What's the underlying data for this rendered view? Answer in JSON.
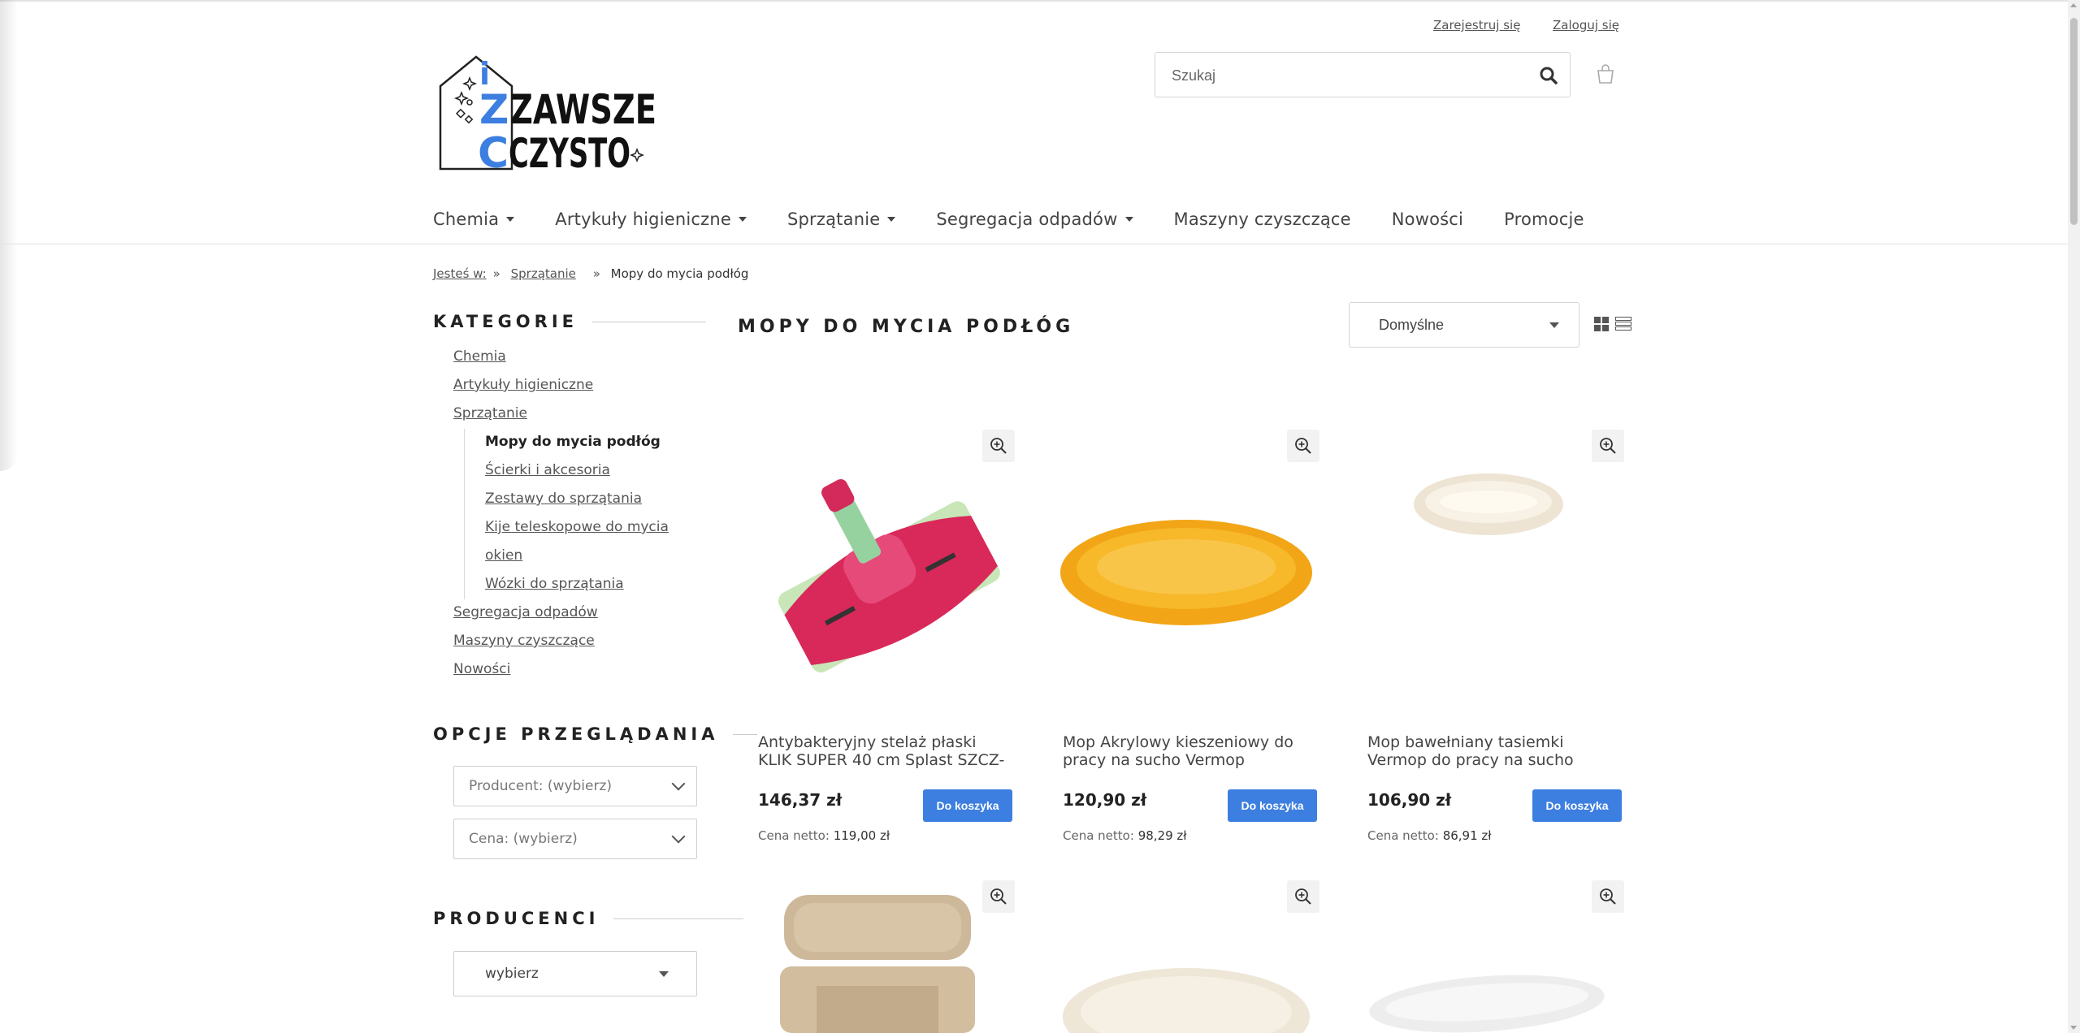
{
  "header": {
    "register_label": "Zarejestruj się",
    "login_label": "Zaloguj się",
    "search_placeholder": "Szukaj",
    "logo_text_line1": "ZAWSZE",
    "logo_text_line2": "CZYSTO",
    "logo_letter_i": "i",
    "logo_letter_z": "Z",
    "logo_letter_c": "C",
    "accent_color": "#3d7fe0"
  },
  "nav": {
    "items": [
      {
        "label": "Chemia",
        "dropdown": true
      },
      {
        "label": "Artykuły higieniczne",
        "dropdown": true
      },
      {
        "label": "Sprzątanie",
        "dropdown": true
      },
      {
        "label": "Segregacja odpadów",
        "dropdown": true
      },
      {
        "label": "Maszyny czyszczące",
        "dropdown": false
      },
      {
        "label": "Nowości",
        "dropdown": false
      },
      {
        "label": "Promocje",
        "dropdown": false
      }
    ]
  },
  "breadcrumb": {
    "prefix": "Jesteś w:",
    "sep": "»",
    "level1": "Sprzątanie",
    "current": "Mopy do mycia podłóg"
  },
  "sidebar": {
    "categories_heading": "KATEGORIE",
    "categories": [
      "Chemia",
      "Artykuły higieniczne",
      "Sprzątanie"
    ],
    "subcategories": [
      "Mopy do mycia podłóg",
      "Ścierki i akcesoria",
      "Zestawy do sprzątania",
      "Kije teleskopowe do mycia",
      "okien",
      "Wózki do sprzątania"
    ],
    "categories_after": [
      "Segregacja odpadów",
      "Maszyny czyszczące",
      "Nowości"
    ],
    "view_options_heading": "OPCJE PRZEGLĄDANIA",
    "producer_filter": "Producent: (wybierz)",
    "price_filter": "Cena: (wybierz)",
    "producers_heading": "PRODUCENCI",
    "producers_select": "wybierz"
  },
  "main": {
    "title": "MOPY DO MYCIA PODŁÓG",
    "sort_value": "Domyślne",
    "products": [
      {
        "name_line1": "Antybakteryjny stelaż płaski",
        "name_line2": "KLIK SUPER 40 cm Splast SZCZ-",
        "price": "146,37 zł",
        "button": "Do koszyka",
        "netto_label": "Cena netto:",
        "netto": "119,00 zł"
      },
      {
        "name_line1": "Mop Akrylowy kieszeniowy do",
        "name_line2": "pracy na sucho Vermop",
        "price": "120,90 zł",
        "button": "Do koszyka",
        "netto_label": "Cena netto:",
        "netto": "98,29 zł"
      },
      {
        "name_line1": "Mop bawełniany tasiemki",
        "name_line2": "Vermop do pracy na sucho",
        "price": "106,90 zł",
        "button": "Do koszyka",
        "netto_label": "Cena netto:",
        "netto": "86,91 zł"
      }
    ]
  }
}
